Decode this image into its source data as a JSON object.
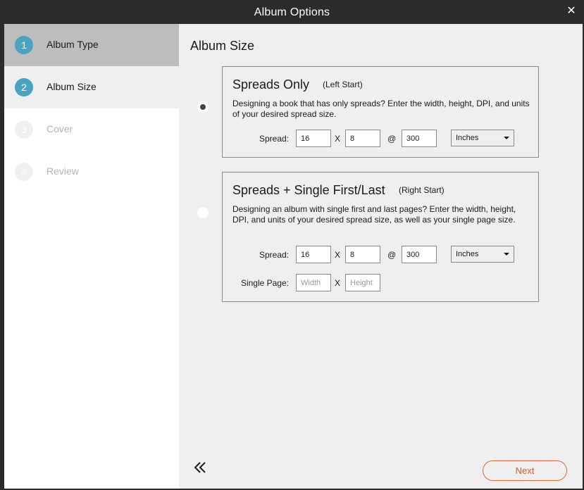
{
  "window": {
    "title": "Album Options",
    "close_icon": "close-icon"
  },
  "steps": [
    {
      "num": "1",
      "label": "Album Type",
      "state": "active"
    },
    {
      "num": "2",
      "label": "Album Size",
      "state": "current"
    },
    {
      "num": "3",
      "label": "Cover",
      "state": "inactive"
    },
    {
      "num": "4",
      "label": "Review",
      "state": "inactive"
    }
  ],
  "main": {
    "heading": "Album Size",
    "options": [
      {
        "title": "Spreads Only",
        "subtitle": "(Left Start)",
        "selected": true,
        "description": "Designing a book that has only spreads? Enter the width, height, DPI, and units of your desired spread size.",
        "spread": {
          "label": "Spread:",
          "width": "16",
          "x": "X",
          "height": "8",
          "at": "@",
          "dpi": "300",
          "units": "Inches"
        }
      },
      {
        "title": "Spreads + Single First/Last",
        "subtitle": "(Right Start)",
        "selected": false,
        "description": "Designing an album with single first and last pages? Enter the width, height, DPI, and units of your desired spread size, as well as your single page size.",
        "spread": {
          "label": "Spread:",
          "width": "16",
          "x": "X",
          "height": "8",
          "at": "@",
          "dpi": "300",
          "units": "Inches"
        },
        "single": {
          "label": "Single Page:",
          "width_placeholder": "Width",
          "x": "X",
          "height_placeholder": "Height"
        }
      }
    ]
  },
  "footer": {
    "back_icon": "double-chevron-left-icon",
    "next_label": "Next"
  },
  "colors": {
    "accent": "#4aa3c2",
    "next": "#e06a3a",
    "titlebar": "#2b2b2b"
  }
}
